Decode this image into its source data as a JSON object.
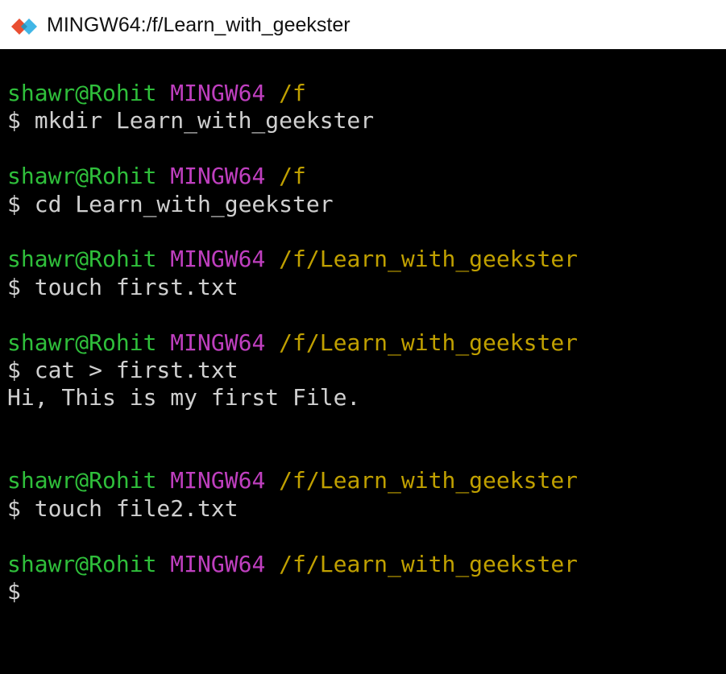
{
  "window": {
    "title": "MINGW64:/f/Learn_with_geekster",
    "icon": "git-diamond-icon"
  },
  "colors": {
    "user": "#2fbf3b",
    "host": "#bf3fbf",
    "path": "#c0a000",
    "text": "#d0d0d0",
    "background": "#000000"
  },
  "terminal": {
    "blocks": [
      {
        "user": "shawr@Rohit",
        "host": "MINGW64",
        "path": "/f",
        "command": "$ mkdir Learn_with_geekster",
        "output": []
      },
      {
        "user": "shawr@Rohit",
        "host": "MINGW64",
        "path": "/f",
        "command": "$ cd Learn_with_geekster",
        "output": []
      },
      {
        "user": "shawr@Rohit",
        "host": "MINGW64",
        "path": "/f/Learn_with_geekster",
        "command": "$ touch first.txt",
        "output": []
      },
      {
        "user": "shawr@Rohit",
        "host": "MINGW64",
        "path": "/f/Learn_with_geekster",
        "command": "$ cat > first.txt",
        "output": [
          "Hi, This is my first File.",
          ""
        ]
      },
      {
        "user": "shawr@Rohit",
        "host": "MINGW64",
        "path": "/f/Learn_with_geekster",
        "command": "$ touch file2.txt",
        "output": []
      },
      {
        "user": "shawr@Rohit",
        "host": "MINGW64",
        "path": "/f/Learn_with_geekster",
        "command": "$",
        "output": []
      }
    ]
  }
}
